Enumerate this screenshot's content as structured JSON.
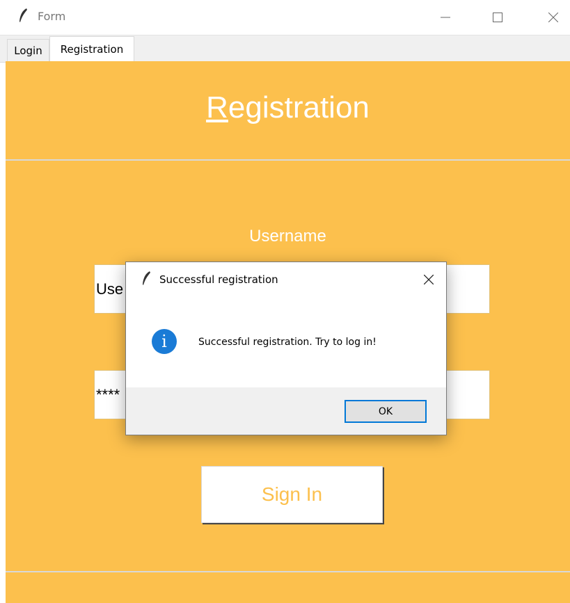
{
  "window": {
    "title": "Form",
    "icons": {
      "app": "feather-icon",
      "minimize": "minimize-icon",
      "maximize": "maximize-icon",
      "close": "close-icon"
    }
  },
  "tabs": [
    {
      "label": "Login"
    },
    {
      "label": "Registration",
      "selected": true
    }
  ],
  "form": {
    "heading_first": "R",
    "heading_rest": "egistration",
    "username_label": "Username",
    "username_value": "Use",
    "password_value": "****",
    "signin_label": "Sign In",
    "accent_color": "#fcc04d"
  },
  "dialog": {
    "title": "Successful registration",
    "message": "Successful registration. Try to log in!",
    "ok_label": "OK",
    "icon": "info-icon",
    "icon_glyph": "i"
  }
}
